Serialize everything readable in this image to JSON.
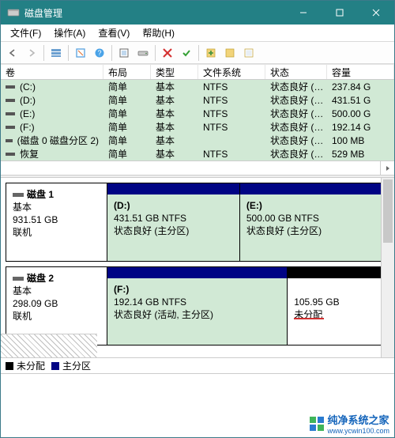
{
  "title": "磁盘管理",
  "menu": {
    "file": "文件(F)",
    "action": "操作(A)",
    "view": "查看(V)",
    "help": "帮助(H)"
  },
  "columns": {
    "volume": "卷",
    "layout": "布局",
    "type": "类型",
    "filesystem": "文件系统",
    "status": "状态",
    "capacity": "容量"
  },
  "volumes": [
    {
      "name": "(C:)",
      "layout": "简单",
      "type": "基本",
      "fs": "NTFS",
      "status": "状态良好 (…",
      "capacity": "237.84 G"
    },
    {
      "name": "(D:)",
      "layout": "简单",
      "type": "基本",
      "fs": "NTFS",
      "status": "状态良好 (…",
      "capacity": "431.51 G"
    },
    {
      "name": "(E:)",
      "layout": "简单",
      "type": "基本",
      "fs": "NTFS",
      "status": "状态良好 (…",
      "capacity": "500.00 G"
    },
    {
      "name": "(F:)",
      "layout": "简单",
      "type": "基本",
      "fs": "NTFS",
      "status": "状态良好 (…",
      "capacity": "192.14 G"
    },
    {
      "name": "(磁盘 0 磁盘分区 2)",
      "layout": "简单",
      "type": "基本",
      "fs": "",
      "status": "状态良好 (…",
      "capacity": "100 MB"
    },
    {
      "name": "恢复",
      "layout": "简单",
      "type": "基本",
      "fs": "NTFS",
      "status": "状态良好 (…",
      "capacity": "529 MB"
    }
  ],
  "disks": [
    {
      "name": "磁盘 1",
      "type": "基本",
      "size": "931.51 GB",
      "status": "联机",
      "parts": [
        {
          "letter": "(D:)",
          "size": "431.51 GB NTFS",
          "status": "状态良好 (主分区)",
          "kind": "primary"
        },
        {
          "letter": "(E:)",
          "size": "500.00 GB NTFS",
          "status": "状态良好 (主分区)",
          "kind": "primary"
        }
      ]
    },
    {
      "name": "磁盘 2",
      "type": "基本",
      "size": "298.09 GB",
      "status": "联机",
      "parts": [
        {
          "letter": "(F:)",
          "size": "192.14 GB NTFS",
          "status": "状态良好 (活动, 主分区)",
          "kind": "primary"
        },
        {
          "letter": "",
          "size": "105.95 GB",
          "status": "未分配",
          "kind": "unalloc"
        }
      ]
    }
  ],
  "legend": {
    "unallocated": "未分配",
    "primary": "主分区"
  },
  "watermark": {
    "text": "纯净系统之家",
    "url": "www.ycwin100.com"
  }
}
